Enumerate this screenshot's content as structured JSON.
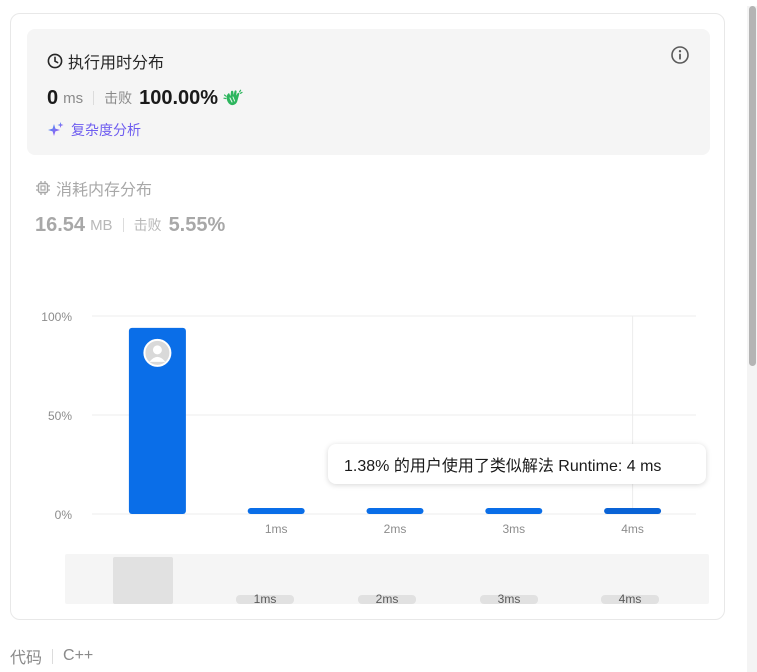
{
  "runtime": {
    "title": "执行用时分布",
    "value": "0",
    "unit": "ms",
    "beat_label": "击败",
    "beat_value": "100.00%",
    "complexity_label": "复杂度分析"
  },
  "memory": {
    "title": "消耗内存分布",
    "value": "16.54",
    "unit": "MB",
    "beat_label": "击败",
    "beat_value": "5.55%"
  },
  "chart_data": {
    "type": "bar",
    "categories": [
      "0ms",
      "1ms",
      "2ms",
      "3ms",
      "4ms"
    ],
    "x_tick_labels": [
      "",
      "1ms",
      "2ms",
      "3ms",
      "4ms"
    ],
    "values": [
      94,
      1.5,
      1.5,
      1.5,
      1.38
    ],
    "yticks": [
      "0%",
      "50%",
      "100%"
    ],
    "ylim": [
      0,
      100
    ],
    "user_marker_category": "0ms",
    "highlight_category": "4ms",
    "bar_color": "#0a6ee8",
    "highlight_color": "#0a63d6",
    "grid": true
  },
  "navigator": {
    "labels": [
      "1ms",
      "2ms",
      "3ms",
      "4ms"
    ]
  },
  "tooltip": {
    "text": "1.38% 的用户使用了类似解法 Runtime: 4 ms"
  },
  "language": {
    "label": "代码",
    "value": "C++"
  },
  "colors": {
    "accent": "#6e5df0",
    "success": "#2db55d",
    "bar": "#0a6ee8"
  },
  "icons": {
    "clock": "clock-icon",
    "info": "info-icon",
    "clap": "clap-icon",
    "sparkle": "sparkle-icon",
    "chip": "chip-icon",
    "avatar": "avatar-icon"
  }
}
